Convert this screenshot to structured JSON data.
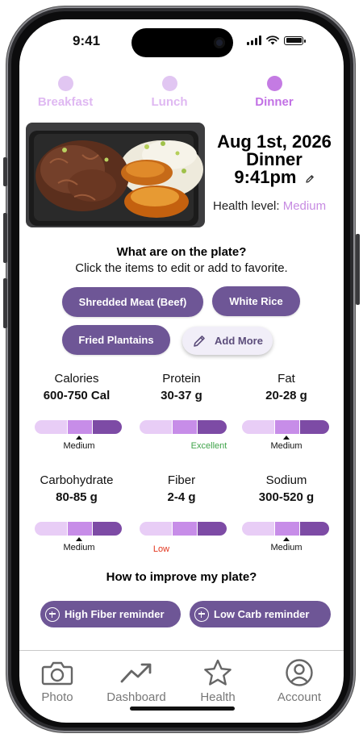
{
  "status_bar": {
    "time": "9:41"
  },
  "meal_tabs": [
    {
      "label": "Breakfast",
      "active": false
    },
    {
      "label": "Lunch",
      "active": false
    },
    {
      "label": "Dinner",
      "active": true
    }
  ],
  "meal": {
    "date": "Aug 1st, 2026",
    "type": "Dinner",
    "time": "9:41pm",
    "health_label": "Health level:",
    "health_value": "Medium"
  },
  "plate": {
    "title": "What are on the plate?",
    "subtitle": "Click the items to edit or add to favorite.",
    "items": [
      "Shredded Meat (Beef)",
      "White Rice",
      "Fried Plantains"
    ],
    "add_more": "Add More"
  },
  "nutrients": [
    {
      "name": "Calories",
      "value": "600-750 Cal",
      "level": "Medium",
      "level_position": 0.5
    },
    {
      "name": "Protein",
      "value": "30-37 g",
      "level": "Excellent",
      "level_position": 0.8
    },
    {
      "name": "Fat",
      "value": "20-28 g",
      "level": "Medium",
      "level_position": 0.5
    },
    {
      "name": "Carbohydrate",
      "value": "80-85 g",
      "level": "Medium",
      "level_position": 0.5
    },
    {
      "name": "Fiber",
      "value": "2-4 g",
      "level": "Low",
      "level_position": 0.2
    },
    {
      "name": "Sodium",
      "value": "300-520 g",
      "level": "Medium",
      "level_position": 0.5
    }
  ],
  "improve": {
    "title": "How to improve my plate?",
    "buttons": [
      "High Fiber reminder",
      "Low Carb reminder"
    ]
  },
  "nav": [
    {
      "label": "Photo",
      "icon": "camera-icon"
    },
    {
      "label": "Dashboard",
      "icon": "trend-icon"
    },
    {
      "label": "Health",
      "icon": "star-icon"
    },
    {
      "label": "Account",
      "icon": "account-icon"
    }
  ],
  "colors": {
    "accent": "#6e5696",
    "active_tab": "#c271e5",
    "inactive_tab": "#dfb8f2",
    "health_value": "#c78be2",
    "excellent": "#3fa34a",
    "low": "#e2341c"
  }
}
